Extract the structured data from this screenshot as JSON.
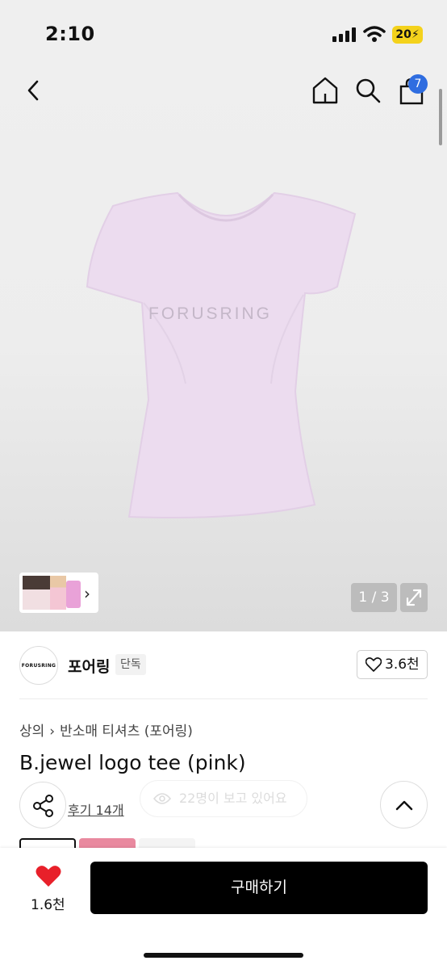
{
  "status_bar": {
    "time": "2:10",
    "battery": "20"
  },
  "header": {
    "cart_badge": "7"
  },
  "gallery": {
    "shirt_color": "#ecdcef",
    "logo_text": "FORUSRING",
    "page_indicator": "1 / 3"
  },
  "brand": {
    "logo_text": "FORUSRING",
    "name": "포어링",
    "tag": "단독",
    "likes": "3.6천"
  },
  "product": {
    "breadcrumb": [
      "상의",
      "반소매 티셔츠 (포어링)"
    ],
    "title": "B.jewel logo tee (pink)",
    "reviews": "후기 14개",
    "viewers": "22명이 보고 있어요"
  },
  "bottom_bar": {
    "wish_count": "1.6천",
    "buy_label": "구매하기"
  },
  "colors": {
    "accent_blue": "#2f6de0",
    "heart_red": "#e8202a",
    "buy_black": "#000000"
  }
}
